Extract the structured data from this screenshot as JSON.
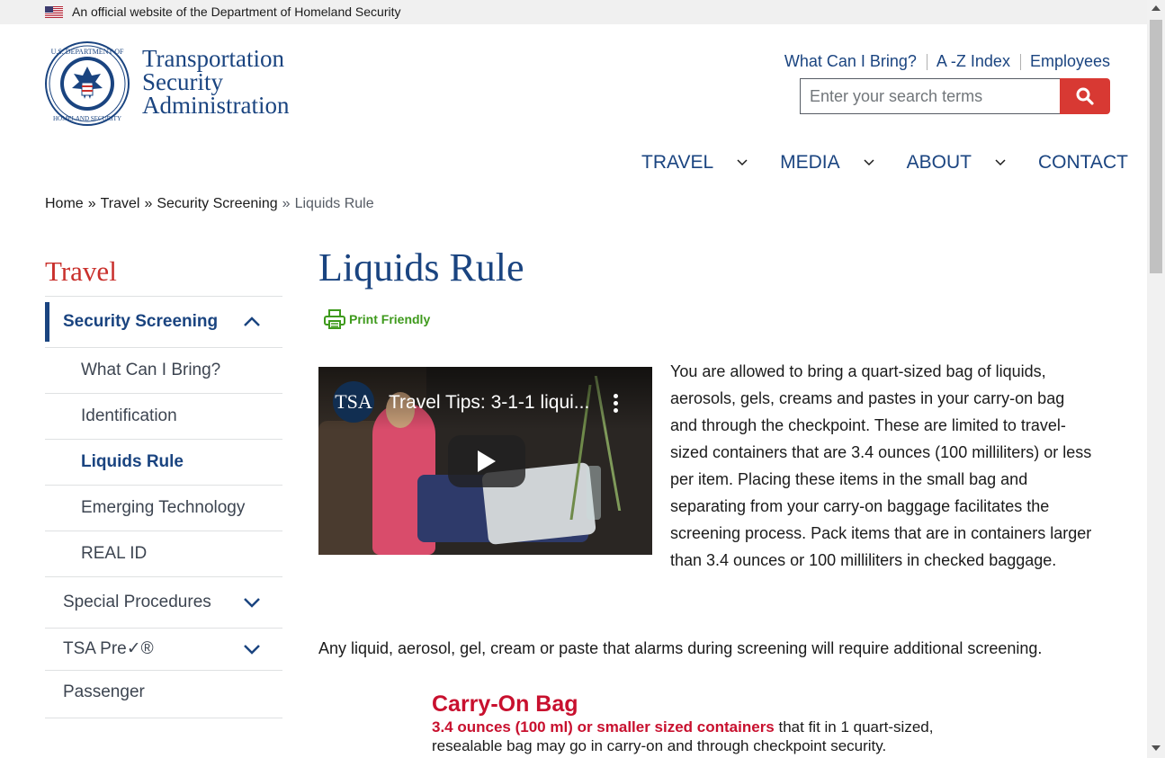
{
  "banner": {
    "text": "An official website of the Department of Homeland Security"
  },
  "logo": {
    "line1": "Transportation",
    "line2": "Security",
    "line3": "Administration"
  },
  "utility_links": [
    "What Can I Bring?",
    "A -Z Index",
    "Employees"
  ],
  "search": {
    "placeholder": "Enter your search terms"
  },
  "nav": {
    "items": [
      "TRAVEL",
      "MEDIA",
      "ABOUT",
      "CONTACT"
    ]
  },
  "breadcrumb": {
    "items": [
      "Home",
      "Travel",
      "Security Screening"
    ],
    "current": "Liquids Rule",
    "separator": "»"
  },
  "sidebar": {
    "title": "Travel",
    "section": "Security Screening",
    "children": [
      "What Can I Bring?",
      "Identification",
      "Liquids Rule",
      "Emerging Technology",
      "REAL ID"
    ],
    "collapsed": [
      "Special Procedures",
      "TSA Pre✓®",
      "Passenger"
    ]
  },
  "content": {
    "title": "Liquids Rule",
    "print_label": "Print Friendly",
    "video": {
      "channel": "TSA",
      "title": "Travel Tips: 3-1-1 liqui..."
    },
    "intro": "You are allowed to bring a quart-sized bag of liquids, aerosols, gels, creams and pastes in your carry-on bag and through the checkpoint. These are limited to travel-sized containers that are 3.4 ounces (100 milliliters) or less per item. Placing these items in the small bag and separating from your carry-on baggage facilitates the screening process. Pack items that are in containers larger than 3.4 ounces or 100 milliliters in checked baggage.",
    "note": "Any liquid, aerosol, gel, cream or paste that alarms during screening will require additional screening.",
    "carry_on": {
      "heading": "Carry-On Bag",
      "highlight": "3.4 ounces (100 ml) or smaller sized containers",
      "rest": " that fit in 1 quart-sized, resealable bag may go in carry-on and through checkpoint security."
    }
  },
  "colors": {
    "brand_blue": "#1a4480",
    "accent_red": "#d83933",
    "sidebar_title_red": "#c9302c",
    "print_green": "#3e9a1c"
  }
}
